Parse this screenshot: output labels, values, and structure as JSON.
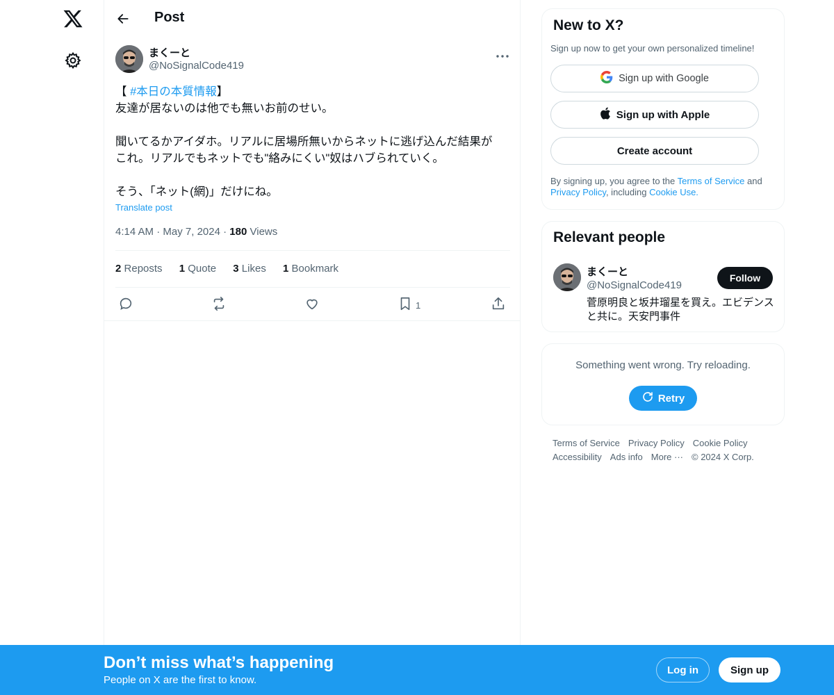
{
  "header": {
    "title": "Post"
  },
  "post": {
    "author_name": "まくーと",
    "author_handle": "@NoSignalCode419",
    "text": {
      "line1_prefix": "【 ",
      "hashtag": "#本日の本質情報",
      "line1_suffix": "】",
      "line2": "友達が居ないのは他でも無いお前のせい。",
      "line3": "聞いてるかアイダホ。リアルに居場所無いからネットに逃げ込んだ結果が",
      "line4": "これ。リアルでもネットでも\"絡みにくい\"奴はハブられていく。",
      "line5": "そう、「ネット(網)」だけにね。"
    },
    "translate_label": "Translate post",
    "time": "4:14 AM",
    "date": "May 7, 2024",
    "views_count": "180",
    "views_label": "Views",
    "stats": {
      "reposts_count": "2",
      "reposts_label": "Reposts",
      "quote_count": "1",
      "quote_label": "Quote",
      "likes_count": "3",
      "likes_label": "Likes",
      "bookmark_count": "1",
      "bookmark_label": "Bookmark"
    },
    "action_bookmark_count": "1"
  },
  "signup_card": {
    "title": "New to X?",
    "subtitle": "Sign up now to get your own personalized timeline!",
    "google_label": "Sign up with Google",
    "apple_label": "Sign up with Apple",
    "create_label": "Create account",
    "legal_prefix": "By signing up, you agree to the ",
    "terms_link": "Terms of Service",
    "legal_and": " and",
    "privacy_link": "Privacy Policy",
    "legal_including": ", including ",
    "cookie_link": "Cookie Use."
  },
  "relevant": {
    "title": "Relevant people",
    "name": "まくーと",
    "handle": "@NoSignalCode419",
    "follow_label": "Follow",
    "bio": "菅原明良と坂井瑠星を買え。エビデンスと共に。天安門事件"
  },
  "error_card": {
    "message": "Something went wrong. Try reloading.",
    "retry_label": "Retry"
  },
  "footer": {
    "terms": "Terms of Service",
    "privacy": "Privacy Policy",
    "cookie": "Cookie Policy",
    "accessibility": "Accessibility",
    "ads": "Ads info",
    "more": "More ···",
    "copyright": "© 2024 X Corp."
  },
  "bottom_bar": {
    "title": "Don’t miss what’s happening",
    "subtitle": "People on X are the first to know.",
    "login_label": "Log in",
    "signup_label": "Sign up"
  },
  "icons": [
    "x-logo-icon",
    "gear-icon",
    "back-arrow-icon",
    "more-icon",
    "reply-icon",
    "repost-icon",
    "like-icon",
    "bookmark-icon",
    "share-icon",
    "google-icon",
    "apple-icon",
    "refresh-icon"
  ],
  "colors": {
    "accent": "#1d9bf0",
    "text": "#0f1419",
    "muted": "#536471",
    "border": "#eff3f4"
  }
}
